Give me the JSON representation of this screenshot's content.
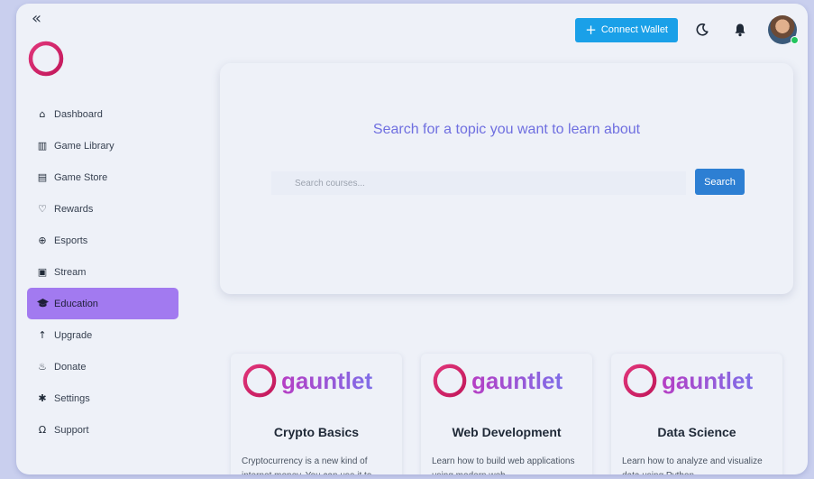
{
  "nav": {
    "collapse_icon": "double-chevron-left-icon",
    "items": [
      {
        "label": "Dashboard",
        "icon": "home-icon"
      },
      {
        "label": "Game Library",
        "icon": "library-icon"
      },
      {
        "label": "Game Store",
        "icon": "store-icon"
      },
      {
        "label": "Rewards",
        "icon": "heart-icon"
      },
      {
        "label": "Esports",
        "icon": "target-icon"
      },
      {
        "label": "Stream",
        "icon": "stream-icon"
      },
      {
        "label": "Education",
        "icon": "graduation-cap-icon"
      },
      {
        "label": "Upgrade",
        "icon": "arrow-up-icon"
      },
      {
        "label": "Donate",
        "icon": "donate-icon"
      },
      {
        "label": "Settings",
        "icon": "gear-icon"
      },
      {
        "label": "Support",
        "icon": "headset-icon"
      }
    ],
    "active": "Education"
  },
  "header": {
    "connect_wallet_label": "Connect Wallet",
    "theme_icon": "moon-icon",
    "notification_icon": "bell-icon",
    "avatar_status": "online"
  },
  "search": {
    "title": "Search for a topic you want to learn about",
    "placeholder": "Search courses...",
    "button_label": "Search"
  },
  "courses": [
    {
      "logo_text": "gauntlet",
      "title": "Crypto Basics",
      "description": "Cryptocurrency is a new kind of internet money. You can use it to"
    },
    {
      "logo_text": "gauntlet",
      "title": "Web Development",
      "description": "Learn how to build web applications using modern web"
    },
    {
      "logo_text": "gauntlet",
      "title": "Data Science",
      "description": "Learn how to analyze and visualize data using Python"
    }
  ],
  "colors": {
    "accent": "#a27af0",
    "primary_button": "#1aa0e8",
    "search_button": "#2d7fd3",
    "brand_pink": "#d6336c"
  }
}
